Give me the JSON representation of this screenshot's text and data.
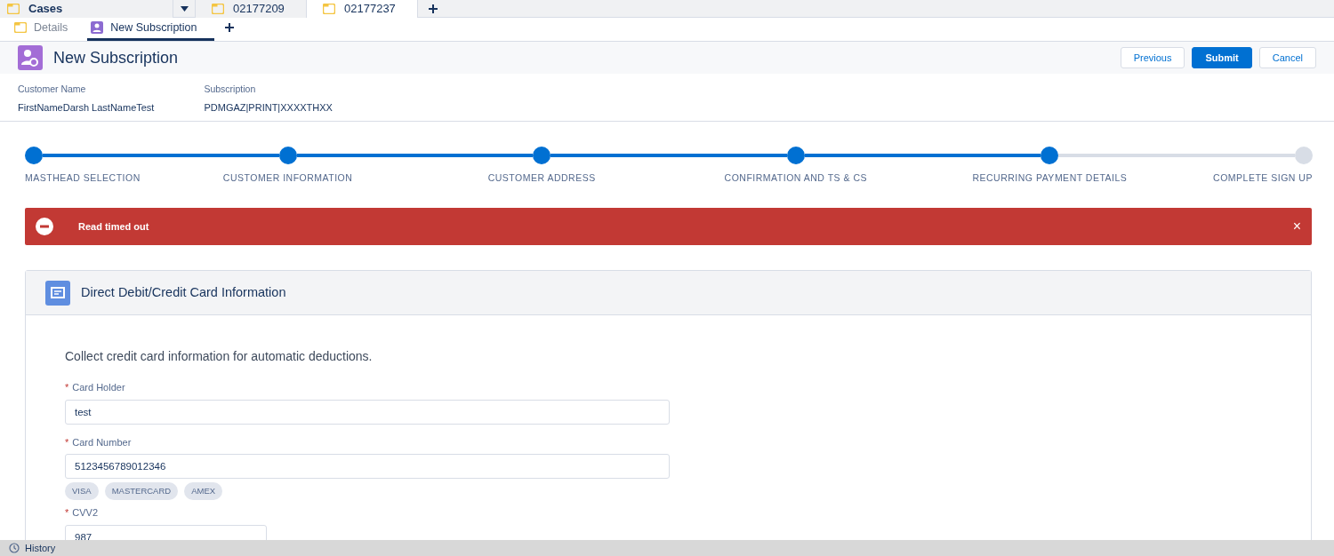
{
  "workspace_tabs": [
    {
      "label": "Cases",
      "selected": false,
      "kind": "app"
    },
    {
      "label": "02177209",
      "selected": false,
      "kind": "record"
    },
    {
      "label": "02177237",
      "selected": true,
      "kind": "record"
    }
  ],
  "subtabs": [
    {
      "label": "Details",
      "selected": false,
      "kind": "folder"
    },
    {
      "label": "New Subscription",
      "selected": true,
      "kind": "flow"
    }
  ],
  "header": {
    "title": "New Subscription",
    "buttons": [
      {
        "label": "Previous",
        "primary": false
      },
      {
        "label": "Submit",
        "primary": true
      },
      {
        "label": "Cancel",
        "primary": false
      }
    ]
  },
  "fields_summary": [
    {
      "label": "Customer Name",
      "value": "FirstNameDarsh LastNameTest"
    },
    {
      "label": "Subscription",
      "value": "PDMGAZ|PRINT|XXXXTHXX"
    }
  ],
  "steps": [
    {
      "label": "MASTHEAD SELECTION",
      "completed": true
    },
    {
      "label": "CUSTOMER INFORMATION",
      "completed": true
    },
    {
      "label": "CUSTOMER ADDRESS",
      "completed": true
    },
    {
      "label": "CONFIRMATION AND TS & CS",
      "completed": true
    },
    {
      "label": "RECURRING PAYMENT DETAILS",
      "completed": true
    },
    {
      "label": "COMPLETE SIGN UP",
      "completed": false
    }
  ],
  "error": {
    "message": "Read timed out",
    "close": "×"
  },
  "card": {
    "title": "Direct Debit/Credit Card Information",
    "description": "Collect credit card information for automatic deductions.",
    "fields": [
      {
        "label": "Card Holder",
        "required_mark": "*",
        "value": "test",
        "kind": "wide"
      },
      {
        "label": "Card Number",
        "required_mark": "*",
        "value": "5123456789012346",
        "kind": "wide",
        "card_types": [
          "VISA",
          "MASTERCARD",
          "AMEX"
        ]
      },
      {
        "label": "CVV2",
        "required_mark": "*",
        "value": "987",
        "kind": "short"
      }
    ]
  },
  "utility_bar": {
    "label": "History"
  }
}
